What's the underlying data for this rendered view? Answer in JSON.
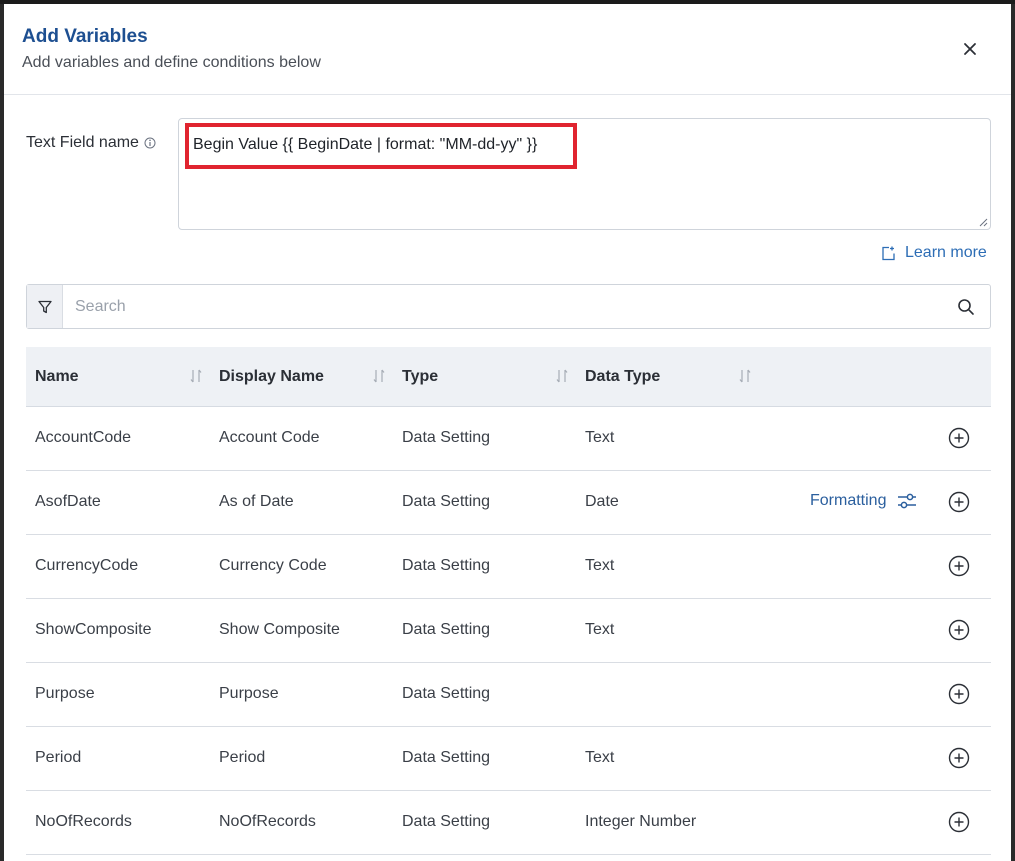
{
  "dialog": {
    "title": "Add Variables",
    "subtitle": "Add variables and define conditions below"
  },
  "text_field": {
    "label": "Text Field name",
    "value": "Begin Value {{ BeginDate | format: \"MM-dd-yy\" }}"
  },
  "learn_more": "Learn more",
  "search": {
    "placeholder": "Search"
  },
  "table": {
    "columns": [
      "Name",
      "Display Name",
      "Type",
      "Data Type"
    ],
    "rows": [
      {
        "name": "AccountCode",
        "display": "Account Code",
        "type": "Data Setting",
        "data_type": "Text",
        "formatting": ""
      },
      {
        "name": "AsofDate",
        "display": "As of Date",
        "type": "Data Setting",
        "data_type": "Date",
        "formatting": "Formatting"
      },
      {
        "name": "CurrencyCode",
        "display": "Currency Code",
        "type": "Data Setting",
        "data_type": "Text",
        "formatting": ""
      },
      {
        "name": "ShowComposite",
        "display": "Show Composite",
        "type": "Data Setting",
        "data_type": "Text",
        "formatting": ""
      },
      {
        "name": "Purpose",
        "display": "Purpose",
        "type": "Data Setting",
        "data_type": "",
        "formatting": ""
      },
      {
        "name": "Period",
        "display": "Period",
        "type": "Data Setting",
        "data_type": "Text",
        "formatting": ""
      },
      {
        "name": "NoOfRecords",
        "display": "NoOfRecords",
        "type": "Data Setting",
        "data_type": "Integer Number",
        "formatting": ""
      }
    ]
  },
  "colors": {
    "accent": "#1d4f91",
    "link": "#2d6db5",
    "highlight": "#e0242f"
  }
}
